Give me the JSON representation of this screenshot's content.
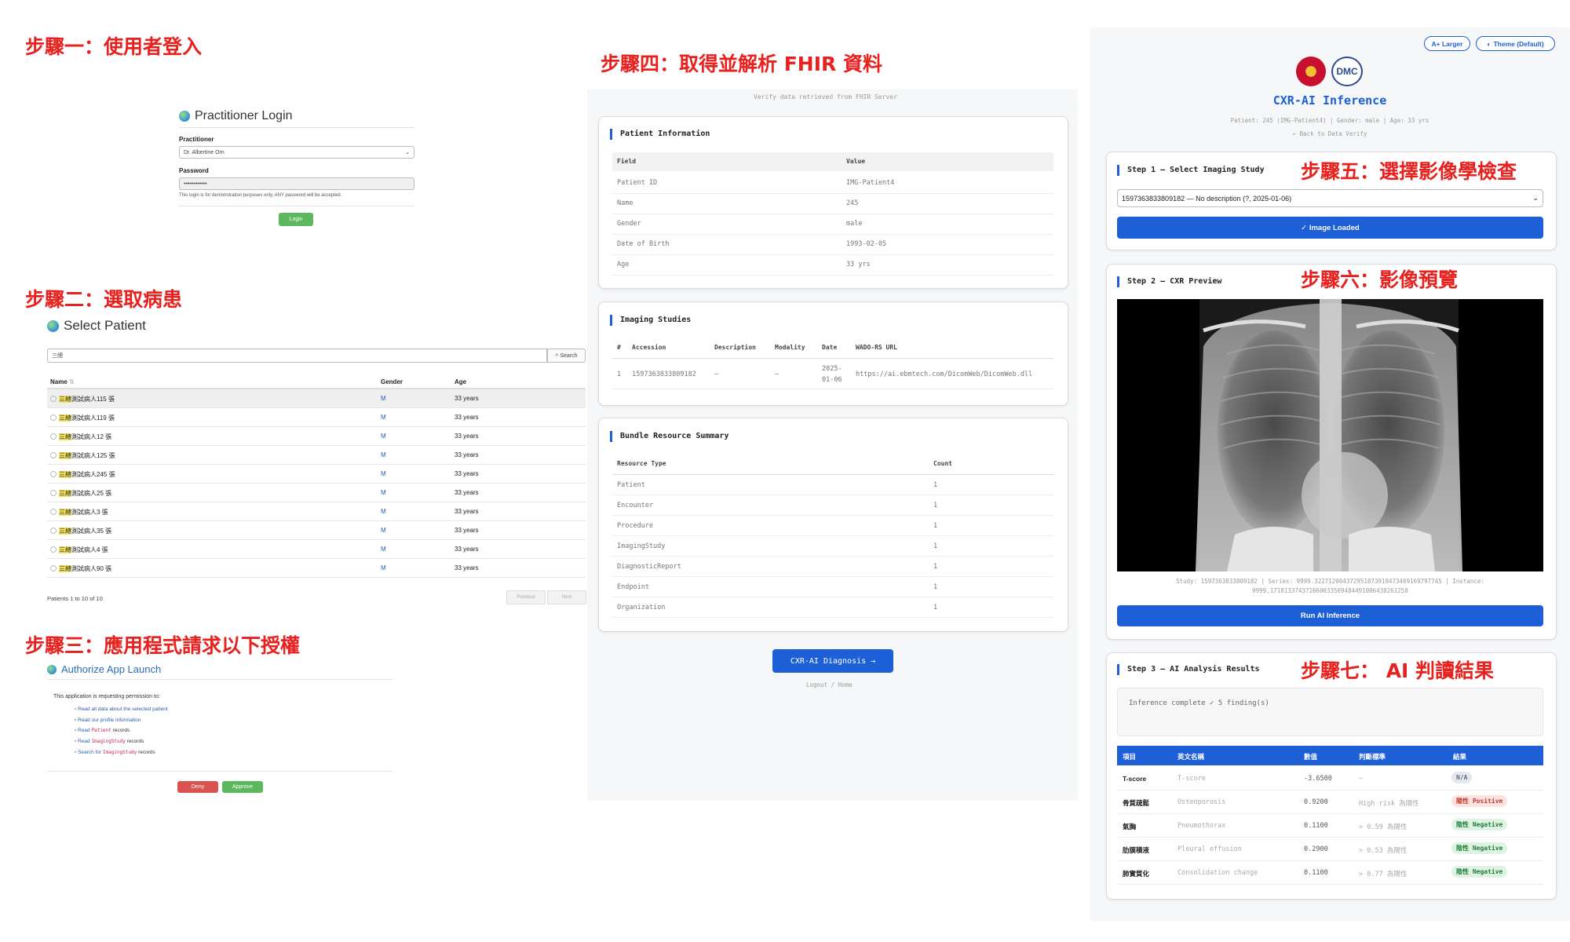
{
  "steps": {
    "s1": "步驟一：使用者登入",
    "s2": "步驟二：選取病患",
    "s3": "步驟三：應用程式請求以下授權",
    "s4": "步驟四：取得並解析 FHIR 資料",
    "s5": "步驟五：選擇影像學檢查",
    "s6": "步驟六：影像預覽",
    "s7": "步驟七： AI 判讀結果"
  },
  "login": {
    "title": "Practitioner Login",
    "practitioner_label": "Practitioner",
    "practitioner_value": "Dr. Albertine Orn",
    "password_label": "Password",
    "password_value": "••••••••••••",
    "note": "This login is for demonstration purposes only. ANY password will be accepted.",
    "button": "Login"
  },
  "select_patient": {
    "title": "Select Patient",
    "search_value": "三總",
    "search_button": "Search",
    "headers": [
      "Name",
      "Gender",
      "Age"
    ],
    "rows": [
      {
        "hl": "三總",
        "name": "測試病人115 張",
        "gender": "M",
        "age": "33 years"
      },
      {
        "hl": "三總",
        "name": "測試病人119 張",
        "gender": "M",
        "age": "33 years"
      },
      {
        "hl": "三總",
        "name": "測試病人12 張",
        "gender": "M",
        "age": "33 years"
      },
      {
        "hl": "三總",
        "name": "測試病人125 張",
        "gender": "M",
        "age": "33 years"
      },
      {
        "hl": "三總",
        "name": "測試病人245 張",
        "gender": "M",
        "age": "33 years"
      },
      {
        "hl": "三總",
        "name": "測試病人25 張",
        "gender": "M",
        "age": "33 years"
      },
      {
        "hl": "三總",
        "name": "測試病人3 張",
        "gender": "M",
        "age": "33 years"
      },
      {
        "hl": "三總",
        "name": "測試病人35 張",
        "gender": "M",
        "age": "33 years"
      },
      {
        "hl": "三總",
        "name": "測試病人4 張",
        "gender": "M",
        "age": "33 years"
      },
      {
        "hl": "三總",
        "name": "測試病人90 張",
        "gender": "M",
        "age": "33 years"
      }
    ],
    "footer": "Patients 1 to 10 of 10",
    "prev": "Previous",
    "next": "Next"
  },
  "authorize": {
    "title": "Authorize App Launch",
    "intro": "This application is requesting permission to:",
    "perms": {
      "p1": "Read all data about the selected patient",
      "p2": "Read our profile information",
      "p3_a": "Read",
      "p3_code": "Patient",
      "p3_b": "records",
      "p4_a": "Read",
      "p4_code": "ImagingStudy",
      "p4_b": "records",
      "p5_a": "Search for",
      "p5_code": "ImagingStudy",
      "p5_b": "records"
    },
    "deny": "Deny",
    "approve": "Approve"
  },
  "fhir": {
    "subtitle": "Verify data retrieved from FHIR Server",
    "patient_info_title": "Patient Information",
    "patient_headers": [
      "Field",
      "Value"
    ],
    "patient_rows": [
      {
        "field": "Patient ID",
        "value": "IMG-Patient4"
      },
      {
        "field": "Name",
        "value": "245"
      },
      {
        "field": "Gender",
        "value": "male"
      },
      {
        "field": "Date of Birth",
        "value": "1993-02-05"
      },
      {
        "field": "Age",
        "value": "33 yrs"
      }
    ],
    "imaging_title": "Imaging Studies",
    "imaging_headers": [
      "#",
      "Accession",
      "Description",
      "Modality",
      "Date",
      "WADO-RS URL"
    ],
    "imaging_row": {
      "num": "1",
      "accession": "1597363833809182",
      "description": "—",
      "modality": "—",
      "date1": "2025-",
      "date2": "01-06",
      "url": "https://ai.ebmtech.com/DicomWeb/DicomWeb.dll"
    },
    "bundle_title": "Bundle Resource Summary",
    "bundle_headers": [
      "Resource Type",
      "Count"
    ],
    "bundle_rows": [
      {
        "type": "Patient",
        "count": "1"
      },
      {
        "type": "Encounter",
        "count": "1"
      },
      {
        "type": "Procedure",
        "count": "1"
      },
      {
        "type": "ImagingStudy",
        "count": "1"
      },
      {
        "type": "DiagnosticReport",
        "count": "1"
      },
      {
        "type": "Endpoint",
        "count": "1"
      },
      {
        "type": "Organization",
        "count": "1"
      }
    ],
    "diagnosis_button": "CXR-AI Diagnosis →",
    "footer_links": "Logout / Home"
  },
  "cxr": {
    "larger_button": "A+ Larger",
    "theme_button": "Theme (Default)",
    "logo_text": "DMC",
    "title": "CXR-AI Inference",
    "patient_line": "Patient: 245 (IMG-Patient4) | Gender: male | Age: 33 yrs",
    "back_link": "← Back to Data Verify",
    "step1_title": "Step 1 — Select Imaging Study",
    "study_select": "1597363833809182 — No description (?, 2025-01-06)",
    "image_loaded": "✓ Image Loaded",
    "step2_title": "Step 2 — CXR Preview",
    "study_line1": "Study: 1597363833809182 | Series: 9999.322712004372951873919473469169797745 | Instance:",
    "study_line2": "9999.171813374371660033509484491006430261258",
    "run_button": "Run AI Inference",
    "step3_title": "Step 3 — AI Analysis Results",
    "inference_status": "Inference complete ✓  5 finding(s)",
    "results_headers": [
      "項目",
      "英文名稱",
      "數值",
      "判斷標準",
      "結果"
    ],
    "results": [
      {
        "item": "T-score",
        "english": "T-score",
        "value": "-3.6500",
        "criteria": "—",
        "result": "N/A",
        "kind": "na"
      },
      {
        "item": "骨質疏鬆",
        "english": "Osteoporosis",
        "value": "0.9200",
        "criteria": "High risk 為陽性",
        "result": "陽性 Positive",
        "kind": "pos"
      },
      {
        "item": "氣胸",
        "english": "Pneumothorax",
        "value": "0.1100",
        "criteria": "> 0.59 為陽性",
        "result": "陰性 Negative",
        "kind": "neg"
      },
      {
        "item": "肋膜積液",
        "english": "Pleural effusion",
        "value": "0.2900",
        "criteria": "> 0.53 為陽性",
        "result": "陰性 Negative",
        "kind": "neg"
      },
      {
        "item": "肺實質化",
        "english": "Consolidation change",
        "value": "0.1100",
        "criteria": "> 0.77 為陽性",
        "result": "陰性 Negative",
        "kind": "neg"
      }
    ]
  },
  "colors": {
    "step_red": "#e8211e",
    "primary_blue": "#1d5fd6",
    "login_green": "#5cb85c",
    "deny_red": "#d9534f"
  }
}
